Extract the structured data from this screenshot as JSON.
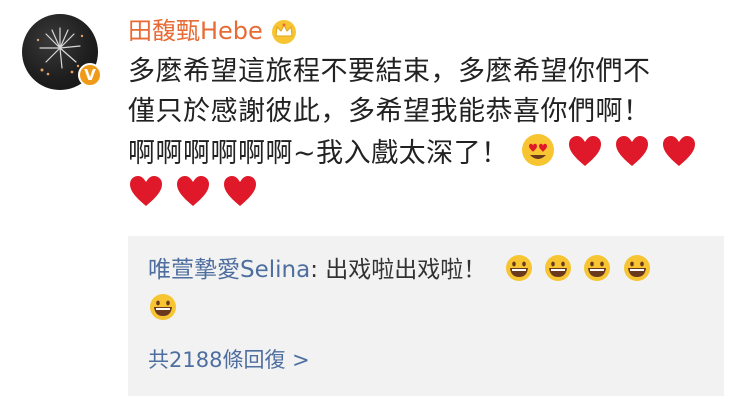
{
  "post": {
    "username": "田馥甄Hebe",
    "badge_icon": "crown-icon",
    "verified_mark": "V",
    "lines": [
      "多麼希望這旅程不要結束，多麼希望你們不",
      "僅只於感謝彼此，多希望我能恭喜你們啊！",
      "啊啊啊啊啊啊~我入戲太深了！"
    ],
    "line3_emojis": [
      "heart-eyes-emoji",
      "red-heart-emoji",
      "red-heart-emoji",
      "red-heart-emoji"
    ],
    "line4_emojis": [
      "red-heart-emoji",
      "red-heart-emoji",
      "red-heart-emoji"
    ]
  },
  "reply": {
    "user": "唯萱摯愛Selina",
    "separator": ": ",
    "text": "出戏啦出戏啦！",
    "emojis": [
      "grinning-emoji",
      "grinning-emoji",
      "grinning-emoji",
      "grinning-emoji",
      "grinning-emoji"
    ],
    "more_label": "共2188條回復 >"
  },
  "colors": {
    "username": "#e86a35",
    "link": "#4e6ea0",
    "reply_bg": "#f2f2f2",
    "heart": "#e0192a",
    "emoji_face": "#f7c531"
  }
}
